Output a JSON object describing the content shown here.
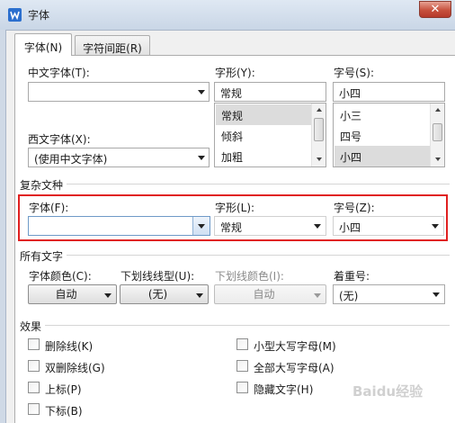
{
  "window": {
    "title": "字体",
    "close_glyph": "✕"
  },
  "tabs": [
    {
      "label": "字体(N)",
      "active": true
    },
    {
      "label": "字符间距(R)",
      "active": false
    }
  ],
  "basic": {
    "chinese_font_label": "中文字体(T):",
    "chinese_font_value": "",
    "western_font_label": "西文字体(X):",
    "western_font_value": "(使用中文字体)",
    "style_label": "字形(Y):",
    "style_value": "常规",
    "style_options": [
      "常规",
      "倾斜",
      "加粗"
    ],
    "style_selected": "常规",
    "size_label": "字号(S):",
    "size_value": "小四",
    "size_options": [
      "小三",
      "四号",
      "小四"
    ],
    "size_selected": "小四"
  },
  "complex": {
    "section_title": "复杂文种",
    "font_label": "字体(F):",
    "font_value": "",
    "style_label": "字形(L):",
    "style_value": "常规",
    "size_label": "字号(Z):",
    "size_value": "小四"
  },
  "all_text": {
    "section_title": "所有文字",
    "font_color_label": "字体颜色(C):",
    "font_color_value": "自动",
    "underline_type_label": "下划线线型(U):",
    "underline_type_value": "(无)",
    "underline_color_label": "下划线颜色(I):",
    "underline_color_value": "自动",
    "emphasis_label": "着重号:",
    "emphasis_value": "(无)"
  },
  "effects": {
    "section_title": "效果",
    "left": [
      "删除线(K)",
      "双删除线(G)",
      "上标(P)",
      "下标(B)"
    ],
    "right": [
      "小型大写字母(M)",
      "全部大写字母(A)",
      "隐藏文字(H)"
    ]
  },
  "watermark": "Baidu经验",
  "colors": {
    "highlight": "#e02020",
    "titlebar": "#c9d6e6",
    "close": "#c7513d"
  }
}
